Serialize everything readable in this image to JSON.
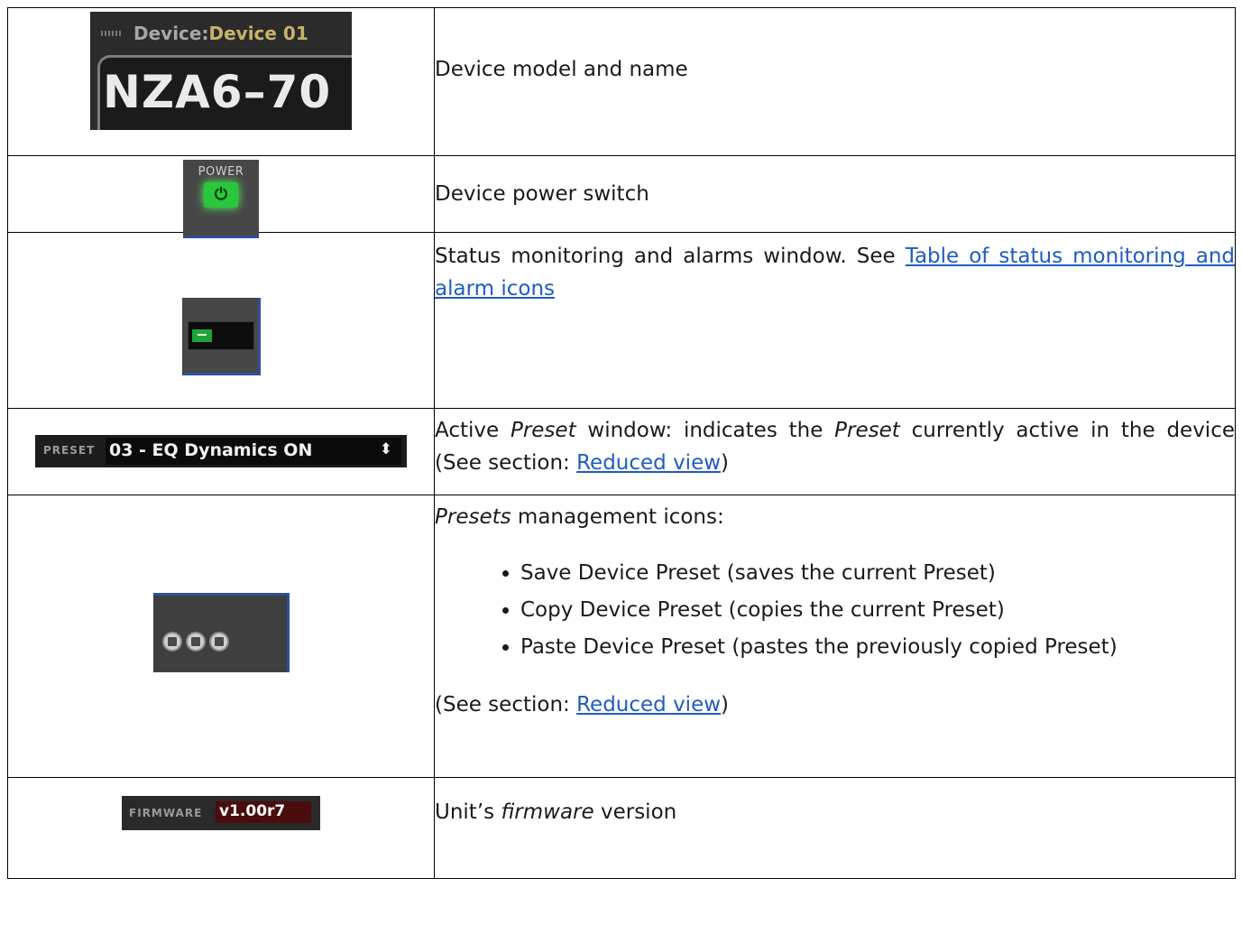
{
  "rows": {
    "r1": {
      "device_label": "Device:",
      "device_name": "Device 01",
      "model": "NZA6–70",
      "description": "Device model and name"
    },
    "r2": {
      "power_label": "POWER",
      "power_glyph": "⏻",
      "description": "Device power switch"
    },
    "r3": {
      "description_text": "Status monitoring and alarms window. See ",
      "link_text": "Table of status monitoring and alarm icons"
    },
    "r4": {
      "preset_label": "PRESET",
      "preset_value": "03 - EQ Dynamics ON",
      "arrow": "⬍",
      "text_parts": [
        "Active ",
        "Preset",
        " window: indicates the ",
        "Preset",
        " currently active in the device (See section: "
      ],
      "link_text": "Reduced view",
      "text_end": ")"
    },
    "r5": {
      "heading_italic": "Presets",
      "heading_rest": " management icons:",
      "items": [
        "Save Device Preset (saves the current Preset)",
        "Copy Device Preset (copies the current Preset)",
        "Paste Device Preset (pastes the previously copied Preset)"
      ],
      "footer_prefix": "(See section: ",
      "footer_link": "Reduced view",
      "footer_suffix": ")"
    },
    "r6": {
      "firmware_label": "FIRMWARE",
      "firmware_value": "v1.00r7",
      "text_prefix": "Unit’s ",
      "text_italic": "firmware",
      "text_suffix": " version"
    }
  }
}
